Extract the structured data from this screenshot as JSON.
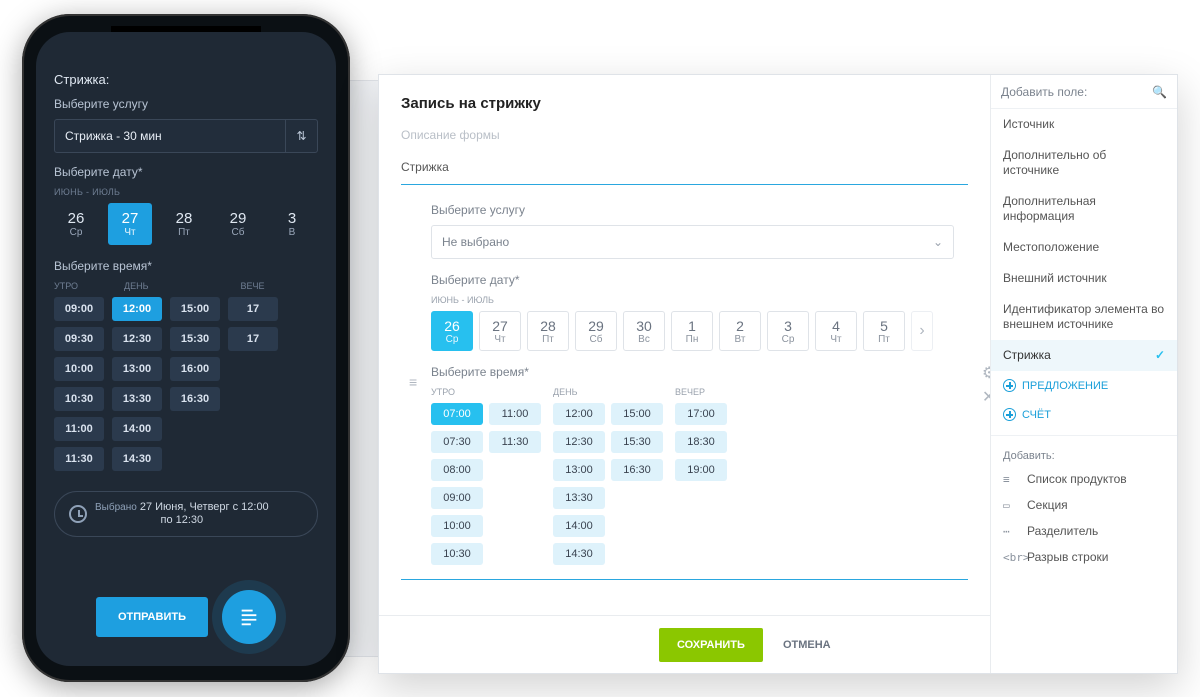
{
  "phone": {
    "title": "Стрижка:",
    "service_label": "Выберите услугу",
    "service_value": "Стрижка - 30 мин",
    "date_label": "Выберите дату*",
    "date_range": "ИЮНЬ - ИЮЛЬ",
    "days": [
      {
        "num": "26",
        "dow": "Ср"
      },
      {
        "num": "27",
        "dow": "Чт",
        "selected": true
      },
      {
        "num": "28",
        "dow": "Пт"
      },
      {
        "num": "29",
        "dow": "Сб"
      },
      {
        "num": "3",
        "dow": "В"
      }
    ],
    "time_label": "Выберите время*",
    "time_headers": [
      "УТРО",
      "ДЕНЬ",
      "ВЕЧЕ"
    ],
    "cols": [
      [
        "09:00",
        "09:30",
        "10:00",
        "10:30",
        "11:00",
        "11:30"
      ],
      [
        "12:00",
        "12:30",
        "13:00",
        "13:30",
        "14:00",
        "14:30"
      ],
      [
        "15:00",
        "15:30",
        "16:00",
        "16:30"
      ],
      [
        "17",
        "17"
      ]
    ],
    "selected_time": "12:00",
    "chosen_label": "Выбрано",
    "chosen_line1": "27 Июня, Четверг с 12:00",
    "chosen_line2": "по 12:30",
    "send": "ОТПРАВИТЬ"
  },
  "desktop": {
    "form_title": "Запись на стрижку",
    "form_desc": "Описание формы",
    "section_label": "Стрижка",
    "service_label": "Выберите услугу",
    "service_value": "Не выбрано",
    "date_label": "Выберите дату*",
    "date_range": "ИЮНЬ - ИЮЛЬ",
    "days": [
      {
        "num": "26",
        "dow": "Ср",
        "selected": true
      },
      {
        "num": "27",
        "dow": "Чт"
      },
      {
        "num": "28",
        "dow": "Пт"
      },
      {
        "num": "29",
        "dow": "Сб"
      },
      {
        "num": "30",
        "dow": "Вс"
      },
      {
        "num": "1",
        "dow": "Пн"
      },
      {
        "num": "2",
        "dow": "Вт"
      },
      {
        "num": "3",
        "dow": "Ср"
      },
      {
        "num": "4",
        "dow": "Чт"
      },
      {
        "num": "5",
        "dow": "Пт"
      }
    ],
    "time_label": "Выберите время*",
    "time_headers": [
      "УТРО",
      "ДЕНЬ",
      "ВЕЧЕР"
    ],
    "morning": [
      [
        "07:00",
        "11:00"
      ],
      [
        "07:30",
        "11:30"
      ],
      [
        "08:00"
      ],
      [
        "09:00"
      ],
      [
        "10:00"
      ],
      [
        "10:30"
      ]
    ],
    "day": [
      [
        "12:00",
        "15:00"
      ],
      [
        "12:30",
        "15:30"
      ],
      [
        "13:00",
        "16:30"
      ],
      [
        "13:30"
      ],
      [
        "14:00"
      ],
      [
        "14:30"
      ]
    ],
    "evening": [
      [
        "17:00"
      ],
      [
        "18:30"
      ],
      [
        "19:00"
      ]
    ],
    "selected_time": "07:00",
    "save": "СОХРАНИТЬ",
    "cancel": "ОТМЕНА"
  },
  "sidebar": {
    "header": "Добавить поле:",
    "fields": [
      "Источник",
      "Дополнительно об источнике",
      "Дополнительная информация",
      "Местоположение",
      "Внешний источник",
      "Идентификатор элемента во внешнем источнике"
    ],
    "selected_field": "Стрижка",
    "add_offer": "ПРЕДЛОЖЕНИЕ",
    "add_invoice": "СЧЁТ",
    "add_header": "Добавить:",
    "elements": [
      {
        "icon": "list",
        "label": "Список продуктов"
      },
      {
        "icon": "section",
        "label": "Секция"
      },
      {
        "icon": "divider",
        "label": "Разделитель"
      },
      {
        "icon": "br",
        "label": "Разрыв строки"
      }
    ]
  }
}
